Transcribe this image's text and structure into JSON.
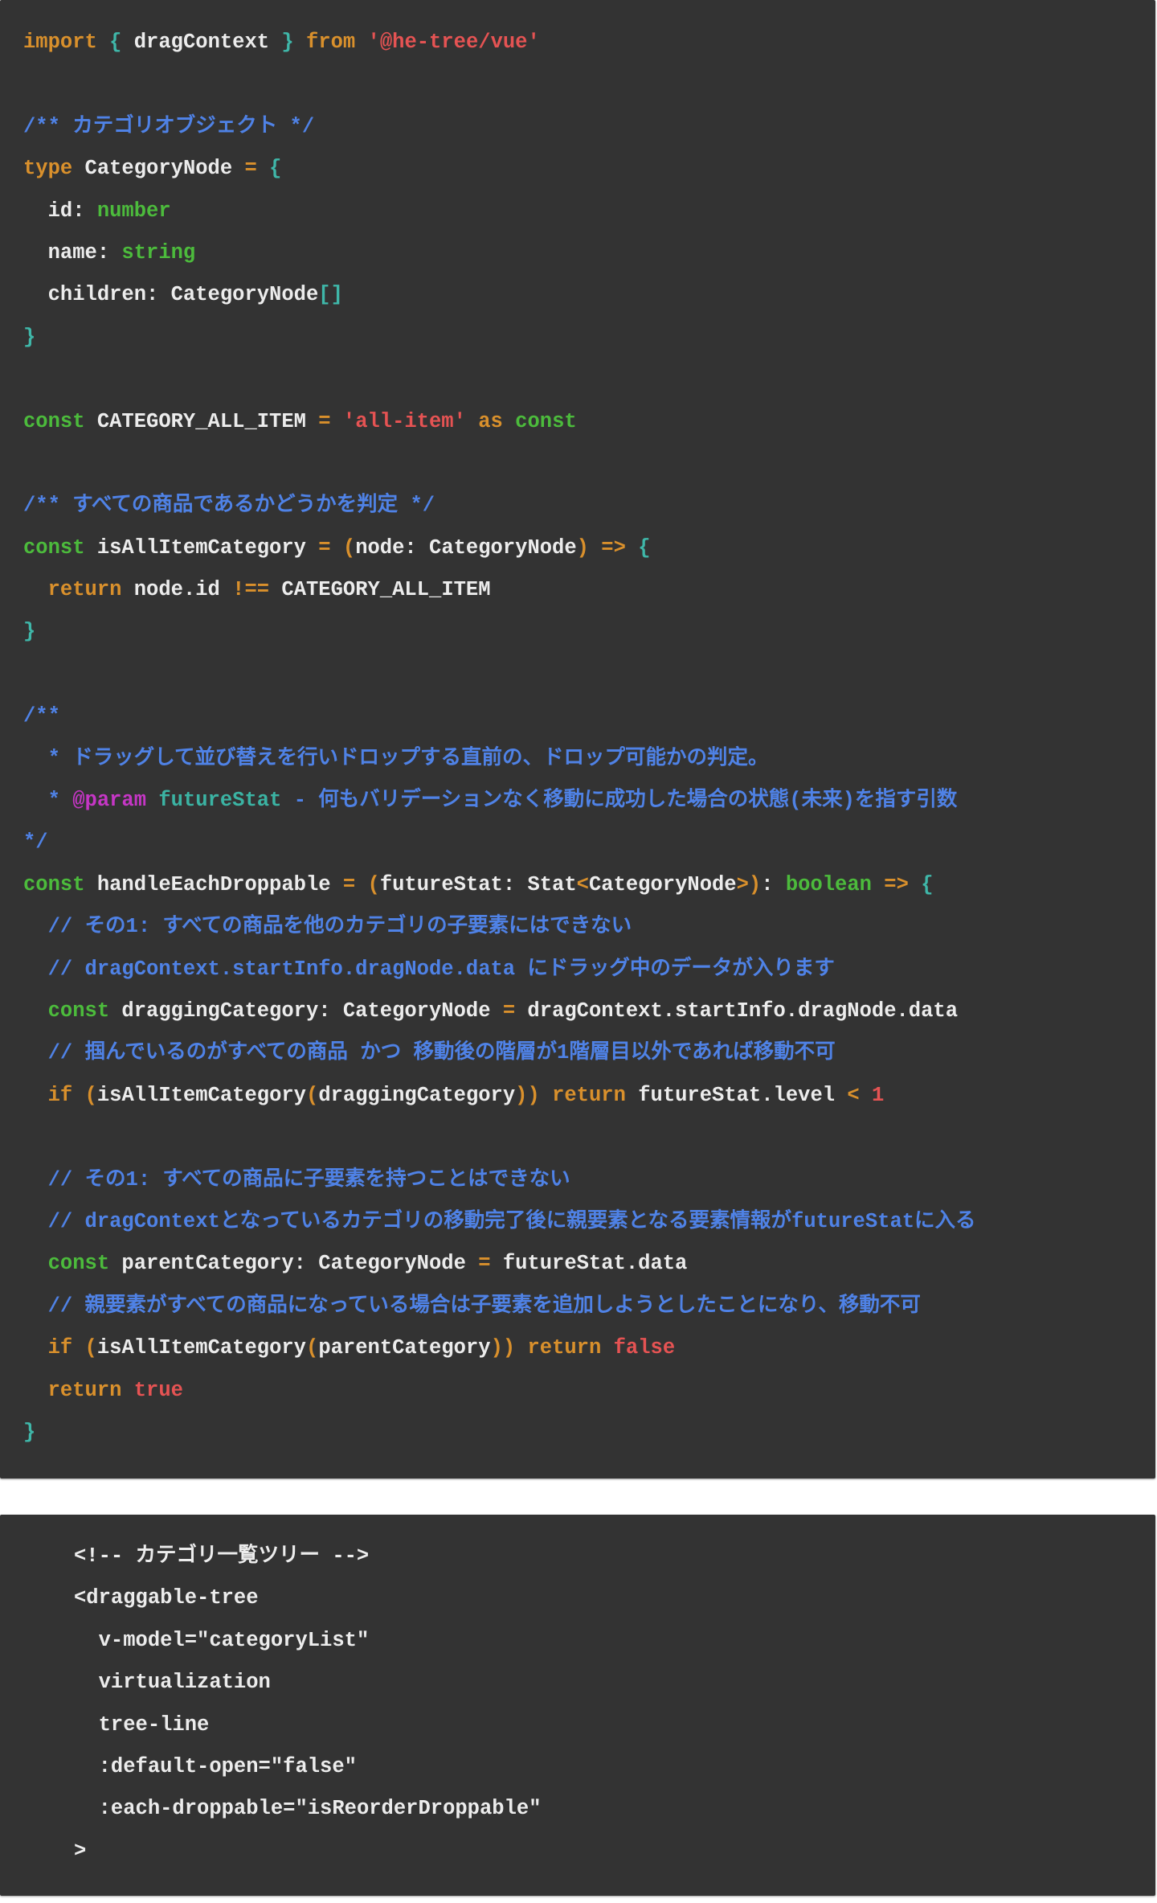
{
  "blocks": [
    {
      "language": "typescript",
      "lines": [
        [
          [
            "kw",
            "import"
          ],
          [
            "id",
            " "
          ],
          [
            "br",
            "{"
          ],
          [
            "id",
            " dragContext "
          ],
          [
            "br",
            "}"
          ],
          [
            "id",
            " "
          ],
          [
            "kw",
            "from"
          ],
          [
            "id",
            " "
          ],
          [
            "str",
            "'@he-tree/vue'"
          ]
        ],
        [],
        [
          [
            "cm",
            "/** カテゴリオブジェクト */"
          ]
        ],
        [
          [
            "kw",
            "type"
          ],
          [
            "id",
            " CategoryNode "
          ],
          [
            "op",
            "="
          ],
          [
            "id",
            " "
          ],
          [
            "br",
            "{"
          ]
        ],
        [
          [
            "id",
            "  id: "
          ],
          [
            "ty",
            "number"
          ]
        ],
        [
          [
            "id",
            "  name: "
          ],
          [
            "ty",
            "string"
          ]
        ],
        [
          [
            "id",
            "  children: CategoryNode"
          ],
          [
            "br",
            "[]"
          ]
        ],
        [
          [
            "br",
            "}"
          ]
        ],
        [],
        [
          [
            "ty",
            "const"
          ],
          [
            "id",
            " CATEGORY_ALL_ITEM "
          ],
          [
            "op",
            "="
          ],
          [
            "id",
            " "
          ],
          [
            "str",
            "'all-item'"
          ],
          [
            "id",
            " "
          ],
          [
            "kw",
            "as"
          ],
          [
            "id",
            " "
          ],
          [
            "ty",
            "const"
          ]
        ],
        [],
        [
          [
            "cm",
            "/** すべての商品であるかどうかを判定 */"
          ]
        ],
        [
          [
            "ty",
            "const"
          ],
          [
            "id",
            " isAllItemCategory "
          ],
          [
            "op",
            "="
          ],
          [
            "id",
            " "
          ],
          [
            "op",
            "("
          ],
          [
            "id",
            "node: CategoryNode"
          ],
          [
            "op",
            ")"
          ],
          [
            "id",
            " "
          ],
          [
            "op",
            "=>"
          ],
          [
            "id",
            " "
          ],
          [
            "br",
            "{"
          ]
        ],
        [
          [
            "id",
            "  "
          ],
          [
            "kw",
            "return"
          ],
          [
            "id",
            " node.id "
          ],
          [
            "op",
            "!=="
          ],
          [
            "id",
            " CATEGORY_ALL_ITEM"
          ]
        ],
        [
          [
            "br",
            "}"
          ]
        ],
        [],
        [
          [
            "cm",
            "/**"
          ]
        ],
        [
          [
            "cm",
            "  * ドラッグして並び替えを行いドロップする直前の、ドロップ可能かの判定。"
          ]
        ],
        [
          [
            "cm",
            "  * "
          ],
          [
            "tag",
            "@param"
          ],
          [
            "id",
            " "
          ],
          [
            "pv",
            "futureStat"
          ],
          [
            "cm",
            " - 何もバリデーションなく移動に成功した場合の状態(未来)を指す引数"
          ]
        ],
        [
          [
            "cm",
            "*/"
          ]
        ],
        [
          [
            "ty",
            "const"
          ],
          [
            "id",
            " handleEachDroppable "
          ],
          [
            "op",
            "="
          ],
          [
            "id",
            " "
          ],
          [
            "op",
            "("
          ],
          [
            "id",
            "futureStat: Stat"
          ],
          [
            "op",
            "<"
          ],
          [
            "id",
            "CategoryNode"
          ],
          [
            "op",
            ">"
          ],
          [
            "op",
            ")"
          ],
          [
            "id",
            ": "
          ],
          [
            "ty",
            "boolean"
          ],
          [
            "id",
            " "
          ],
          [
            "op",
            "=>"
          ],
          [
            "id",
            " "
          ],
          [
            "br",
            "{"
          ]
        ],
        [
          [
            "cm",
            "  // その1: すべての商品を他のカテゴリの子要素にはできない"
          ]
        ],
        [
          [
            "cm",
            "  // dragContext.startInfo.dragNode.data にドラッグ中のデータが入ります"
          ]
        ],
        [
          [
            "id",
            "  "
          ],
          [
            "ty",
            "const"
          ],
          [
            "id",
            " draggingCategory: CategoryNode "
          ],
          [
            "op",
            "="
          ],
          [
            "id",
            " dragContext.startInfo.dragNode.data"
          ]
        ],
        [
          [
            "cm",
            "  // 掴んでいるのがすべての商品 かつ 移動後の階層が1階層目以外であれば移動不可"
          ]
        ],
        [
          [
            "id",
            "  "
          ],
          [
            "kw",
            "if"
          ],
          [
            "id",
            " "
          ],
          [
            "op",
            "("
          ],
          [
            "id",
            "isAllItemCategory"
          ],
          [
            "op",
            "("
          ],
          [
            "id",
            "draggingCategory"
          ],
          [
            "op",
            "))"
          ],
          [
            "id",
            " "
          ],
          [
            "kw",
            "return"
          ],
          [
            "id",
            " futureStat.level "
          ],
          [
            "op",
            "<"
          ],
          [
            "id",
            " "
          ],
          [
            "num",
            "1"
          ]
        ],
        [],
        [
          [
            "cm",
            "  // その1: すべての商品に子要素を持つことはできない"
          ]
        ],
        [
          [
            "cm",
            "  // dragContextとなっているカテゴリの移動完了後に親要素となる要素情報がfutureStatに入る"
          ]
        ],
        [
          [
            "id",
            "  "
          ],
          [
            "ty",
            "const"
          ],
          [
            "id",
            " parentCategory: CategoryNode "
          ],
          [
            "op",
            "="
          ],
          [
            "id",
            " futureStat.data"
          ]
        ],
        [
          [
            "cm",
            "  // 親要素がすべての商品になっている場合は子要素を追加しようとしたことになり、移動不可"
          ]
        ],
        [
          [
            "id",
            "  "
          ],
          [
            "kw",
            "if"
          ],
          [
            "id",
            " "
          ],
          [
            "op",
            "("
          ],
          [
            "id",
            "isAllItemCategory"
          ],
          [
            "op",
            "("
          ],
          [
            "id",
            "parentCategory"
          ],
          [
            "op",
            "))"
          ],
          [
            "id",
            " "
          ],
          [
            "kw",
            "return"
          ],
          [
            "id",
            " "
          ],
          [
            "str",
            "false"
          ]
        ],
        [
          [
            "id",
            "  "
          ],
          [
            "kw",
            "return"
          ],
          [
            "id",
            " "
          ],
          [
            "str",
            "true"
          ]
        ],
        [
          [
            "br",
            "}"
          ]
        ]
      ]
    },
    {
      "language": "html",
      "lines": [
        [
          [
            "tx",
            "<!-- カテゴリ一覧ツリー -->"
          ]
        ],
        [
          [
            "tx",
            "<draggable-tree"
          ]
        ],
        [
          [
            "tx",
            "  v-model=\"categoryList\""
          ]
        ],
        [
          [
            "tx",
            "  virtualization"
          ]
        ],
        [
          [
            "tx",
            "  tree-line"
          ]
        ],
        [
          [
            "tx",
            "  :default-open=\"false\""
          ]
        ],
        [
          [
            "tx",
            "  :each-droppable=\"isReorderDroppable\""
          ]
        ],
        [
          [
            "tx",
            ">"
          ]
        ]
      ]
    }
  ]
}
